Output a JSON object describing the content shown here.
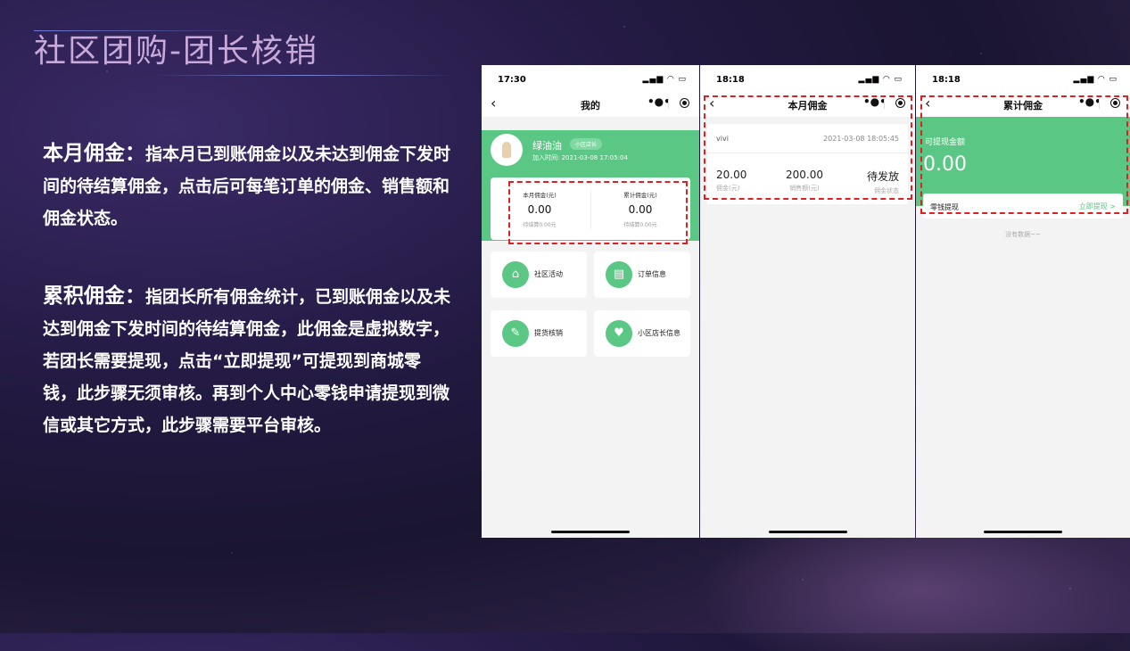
{
  "slide": {
    "title": "社区团购-团长核销",
    "desc1_head": "本月佣金：",
    "desc1_body": "指本月已到账佣金以及未达到佣金下发时间的待结算佣金，点击后可每笔订单的佣金、销售额和佣金状态。",
    "desc2_head": "累积佣金：",
    "desc2_body": "指团长所有佣金统计，已到账佣金以及未达到佣金下发时间的待结算佣金，此佣金是虚拟数字，若团长需要提现，点击“立即提现”可提现到商城零钱，此步骤无须审核。再到个人中心零钱申请提现到微信或其它方式，此步骤需要平台审核。"
  },
  "screen1": {
    "time": "17:30",
    "title": "我的",
    "user_name": "绿油油",
    "user_tag": "小区店长",
    "join_time": "加入时间: 2021-03-08 17:05:04",
    "month_label": "本月佣金(元)",
    "month_value": "0.00",
    "month_sub": "待结算0.00元",
    "total_label": "累计佣金(元)",
    "total_value": "0.00",
    "total_sub": "待结算0.00元",
    "tiles": [
      "社区活动",
      "订单信息",
      "提货核销",
      "小区店长信息"
    ]
  },
  "screen2": {
    "time": "18:18",
    "title": "本月佣金",
    "name": "vivi",
    "date": "2021-03-08 18:05:45",
    "commission": "20.00",
    "commission_label": "佣金(元)",
    "sales": "200.00",
    "sales_label": "销售额(元)",
    "status": "待发放",
    "status_label": "佣金状态"
  },
  "screen3": {
    "time": "18:18",
    "title": "累计佣金",
    "amount_label": "可提现金额",
    "amount": "0.00",
    "wallet_label": "零钱提现",
    "withdraw_label": "立即提现 >",
    "no_data": "没有数据~~"
  },
  "colors": {
    "accent_green": "#5ac884",
    "highlight_red": "#e02020"
  }
}
